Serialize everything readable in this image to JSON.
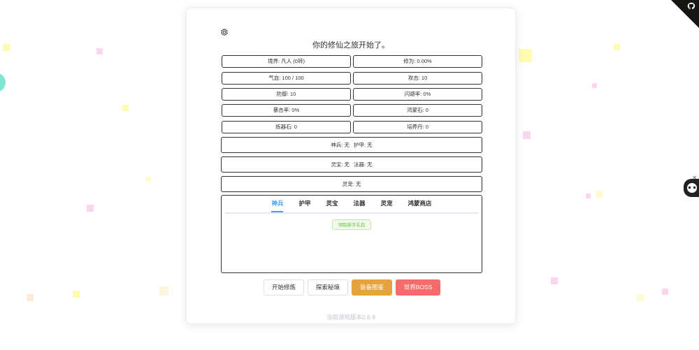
{
  "log": {
    "title": "你的修仙之旅开始了。"
  },
  "stats": {
    "realm": "境界: 凡人 (0转)",
    "cultivation": "修为: 0.00%",
    "health": "气血: 100 / 100",
    "attack": "攻击: 10",
    "defense": "防御: 10",
    "dodge": "闪避率: 0%",
    "crit": "暴击率: 0%",
    "hongmeng_stone": "鸿蒙石: 0",
    "refine_stone": "炼器石: 0",
    "pill": "培养丹: 0"
  },
  "equipment": {
    "weapon": "神兵: 无",
    "armor": "护甲: 无",
    "treasure": "灵宝: 无",
    "magic_tool": "法器: 无",
    "pet": "灵宠: 无"
  },
  "tabs": [
    {
      "label": "神兵",
      "active": true
    },
    {
      "label": "护甲",
      "active": false
    },
    {
      "label": "灵宝",
      "active": false
    },
    {
      "label": "法器",
      "active": false
    },
    {
      "label": "灵宠",
      "active": false
    },
    {
      "label": "鸿蒙商店",
      "active": false
    }
  ],
  "tab_content": {
    "gift_button": "领取新手礼包"
  },
  "actions": {
    "start_cultivate": "开始修炼",
    "explore": "探索秘境",
    "equipment_gallery": "装备图鉴",
    "world_boss": "世界BOSS"
  },
  "footer": {
    "version": "当前游戏版本0.6.8"
  },
  "colors": {
    "primary": "#409eff",
    "warning": "#e6a23c",
    "danger": "#f56c6c",
    "success": "#67c23a"
  },
  "icons": [
    "settings-icon",
    "github-corner-icon",
    "avatar-icon"
  ]
}
